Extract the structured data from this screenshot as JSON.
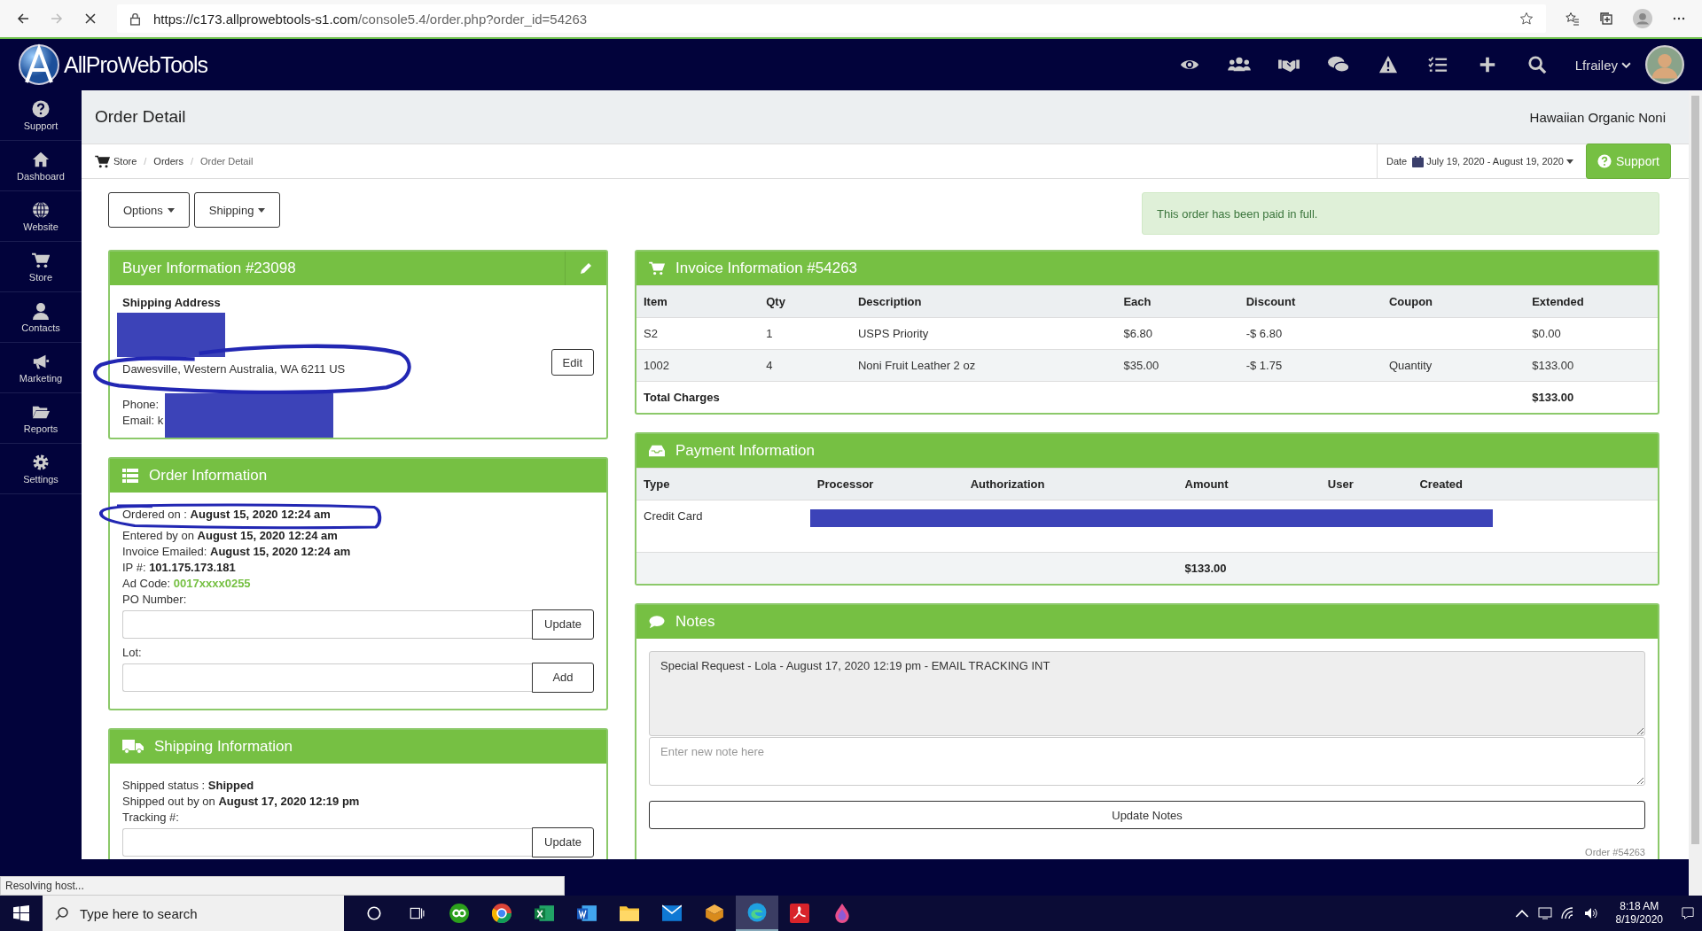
{
  "browser": {
    "url_host": "https://c173.allprowebtools-s1.com",
    "url_path": "/console5.4/order.php?order_id=54263",
    "status_text": "Resolving host..."
  },
  "app": {
    "brand": "AllProWebTools",
    "user": "Lfrailey"
  },
  "sidebar": {
    "items": [
      {
        "label": "Support"
      },
      {
        "label": "Dashboard"
      },
      {
        "label": "Website"
      },
      {
        "label": "Store"
      },
      {
        "label": "Contacts"
      },
      {
        "label": "Marketing"
      },
      {
        "label": "Reports"
      },
      {
        "label": "Settings"
      }
    ]
  },
  "page": {
    "title": "Order Detail",
    "store_name": "Hawaiian Organic Noni",
    "breadcrumb": [
      "Store",
      "Orders",
      "Order Detail"
    ],
    "breadcrumb_separator": "/",
    "date_label": "Date",
    "date_range": "July 19, 2020 - August 19, 2020",
    "support_button": "Support",
    "buttons": [
      "Options",
      "Shipping"
    ],
    "alert": "This order has been paid in full."
  },
  "buyer": {
    "title": "Buyer Information #23098",
    "shipping_label": "Shipping Address",
    "address": "Dawesville, Western Australia, WA 6211 US",
    "phone_label": "Phone:",
    "email_label": "Email: k",
    "edit_button": "Edit"
  },
  "order_info": {
    "title": "Order Information",
    "lines": [
      {
        "label": "Ordered on :",
        "value": "August 15, 2020 12:24 am",
        "kind": "text"
      },
      {
        "label": "Entered by on",
        "value": "August 15, 2020 12:24 am",
        "kind": "text"
      },
      {
        "label": "Invoice Emailed:",
        "value": "August 15, 2020 12:24 am",
        "kind": "text"
      },
      {
        "label": "IP #:",
        "value": "101.175.173.181",
        "kind": "text"
      },
      {
        "label": "Ad Code:",
        "value": "0017xxxx0255",
        "kind": "link"
      }
    ],
    "po_label": "PO Number:",
    "po_button": "Update",
    "lot_label": "Lot:",
    "lot_button": "Add"
  },
  "shipping": {
    "title": "Shipping Information",
    "lines": [
      {
        "label": "Shipped status :",
        "value": "Shipped"
      },
      {
        "label": "Shipped out by on",
        "value": "August 17, 2020 12:19 pm"
      }
    ],
    "tracking_label": "Tracking #:",
    "tracking_button": "Update"
  },
  "invoice": {
    "title": "Invoice Information #54263",
    "columns": [
      "Item",
      "Qty",
      "Description",
      "Each",
      "Discount",
      "Coupon",
      "Extended"
    ],
    "rows": [
      [
        "S2",
        "1",
        "USPS Priority",
        "$6.80",
        "-$ 6.80",
        "",
        "$0.00"
      ],
      [
        "1002",
        "4",
        "Noni Fruit Leather 2 oz",
        "$35.00",
        "-$ 1.75",
        "Quantity",
        "$133.00"
      ]
    ],
    "total_label": "Total Charges",
    "total": "$133.00"
  },
  "payment": {
    "title": "Payment Information",
    "columns": [
      "Type",
      "Processor",
      "Authorization",
      "Amount",
      "User",
      "Created"
    ],
    "rows": [
      {
        "type": "Credit Card"
      }
    ],
    "total": "$133.00"
  },
  "notes": {
    "title": "Notes",
    "existing": "Special Request - Lola - August 17, 2020 12:19 pm - EMAIL TRACKING INT",
    "placeholder": "Enter new note here",
    "button": "Update Notes",
    "order_ref": "Order #54263"
  },
  "taskbar": {
    "search_placeholder": "Type here to search",
    "time": "8:18 AM",
    "date": "8/19/2020"
  }
}
